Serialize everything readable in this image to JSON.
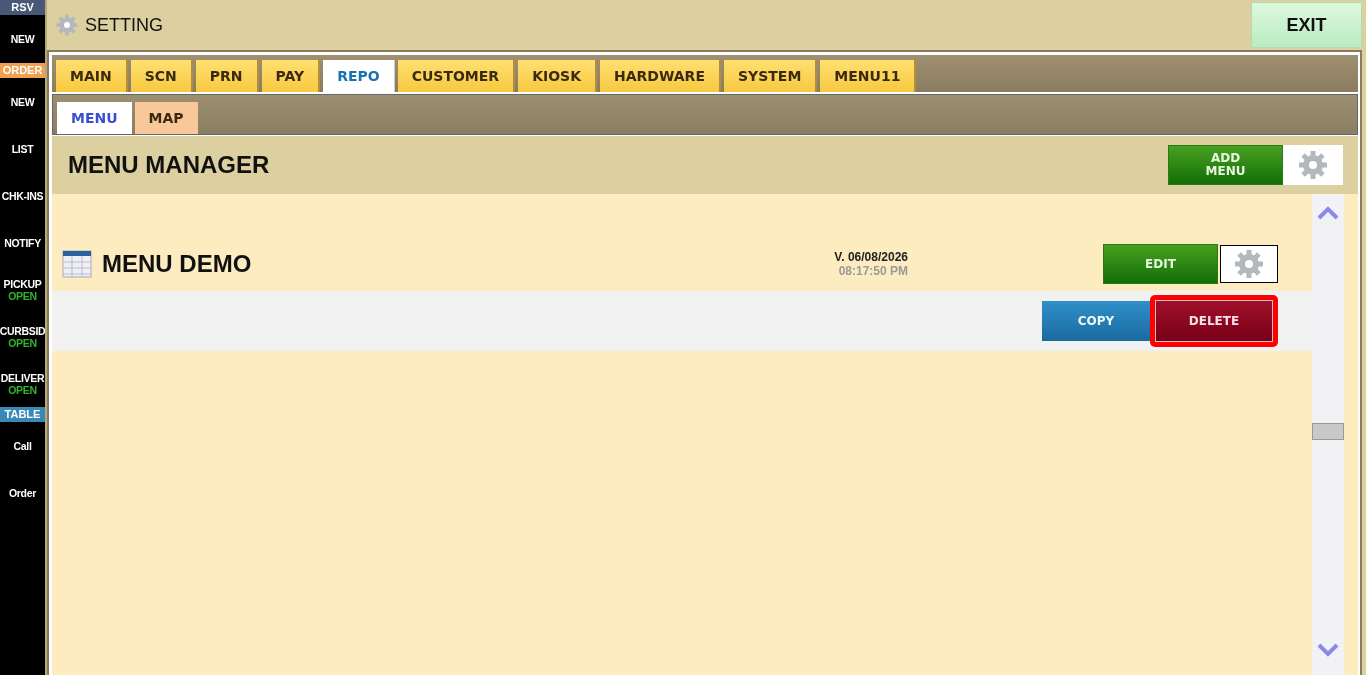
{
  "sidebar": [
    {
      "kind": "header",
      "label": "RSV",
      "color": "#4a5878"
    },
    {
      "kind": "item",
      "label": "NEW"
    },
    {
      "kind": "header",
      "label": "ORDER",
      "color": "#f0a050"
    },
    {
      "kind": "item",
      "label": "NEW"
    },
    {
      "kind": "item",
      "label": "LIST"
    },
    {
      "kind": "item",
      "label": "CHK-INS"
    },
    {
      "kind": "item",
      "label": "NOTIFY"
    },
    {
      "kind": "item",
      "label": "PICKUP",
      "status": "OPEN"
    },
    {
      "kind": "item",
      "label": "CURBSID",
      "status": "OPEN"
    },
    {
      "kind": "item",
      "label": "DELIVER",
      "status": "OPEN"
    },
    {
      "kind": "header",
      "label": "TABLE",
      "color": "#3a88b8"
    },
    {
      "kind": "item",
      "label": "Call"
    },
    {
      "kind": "item",
      "label": "Order"
    }
  ],
  "window": {
    "title": "SETTING",
    "exit": "EXIT"
  },
  "tabs": [
    {
      "label": "MAIN",
      "selected": false
    },
    {
      "label": "SCN",
      "selected": false
    },
    {
      "label": "PRN",
      "selected": false
    },
    {
      "label": "PAY",
      "selected": false
    },
    {
      "label": "REPO",
      "selected": true
    },
    {
      "label": "CUSTOMER",
      "selected": false
    },
    {
      "label": "KIOSK",
      "selected": false
    },
    {
      "label": "HARDWARE",
      "selected": false
    },
    {
      "label": "SYSTEM",
      "selected": false
    },
    {
      "label": "MENU11",
      "selected": false
    }
  ],
  "subtabs": [
    {
      "label": "MENU",
      "selected": true
    },
    {
      "label": "MAP",
      "selected": false
    }
  ],
  "manager": {
    "title": "MENU MANAGER",
    "add_button": "ADD\nMENU"
  },
  "menus": [
    {
      "name": "MENU DEMO",
      "version": "V. 06/08/2026",
      "time": "08:17:50 PM",
      "edit": "EDIT",
      "copy": "COPY",
      "delete": "DELETE",
      "delete_highlighted": true
    }
  ]
}
